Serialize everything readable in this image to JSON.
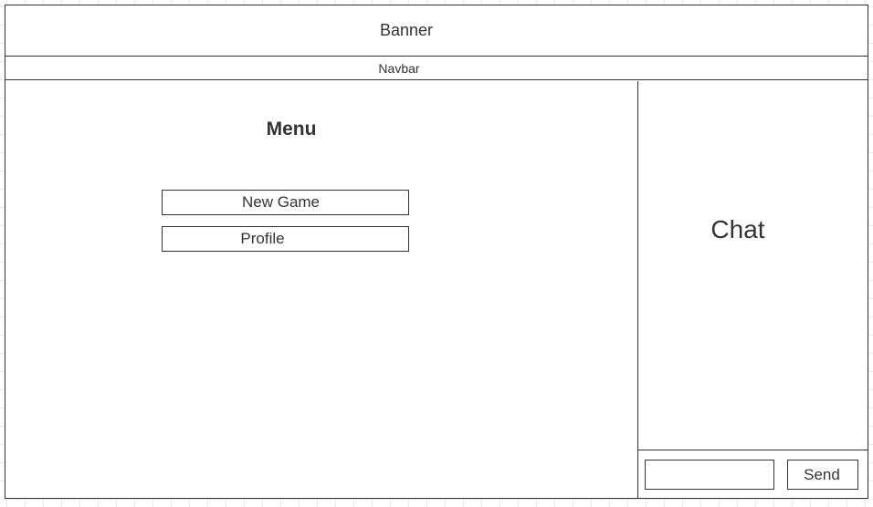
{
  "header": {
    "banner_label": "Banner",
    "navbar_label": "Navbar"
  },
  "menu": {
    "title": "Menu",
    "items": [
      {
        "label": "New Game"
      },
      {
        "label": "Profile"
      }
    ]
  },
  "chat": {
    "title": "Chat",
    "input_value": "",
    "send_label": "Send"
  },
  "colors": {
    "line": "#333333",
    "background": "#ffffff",
    "grid": "#e9e9e9"
  }
}
